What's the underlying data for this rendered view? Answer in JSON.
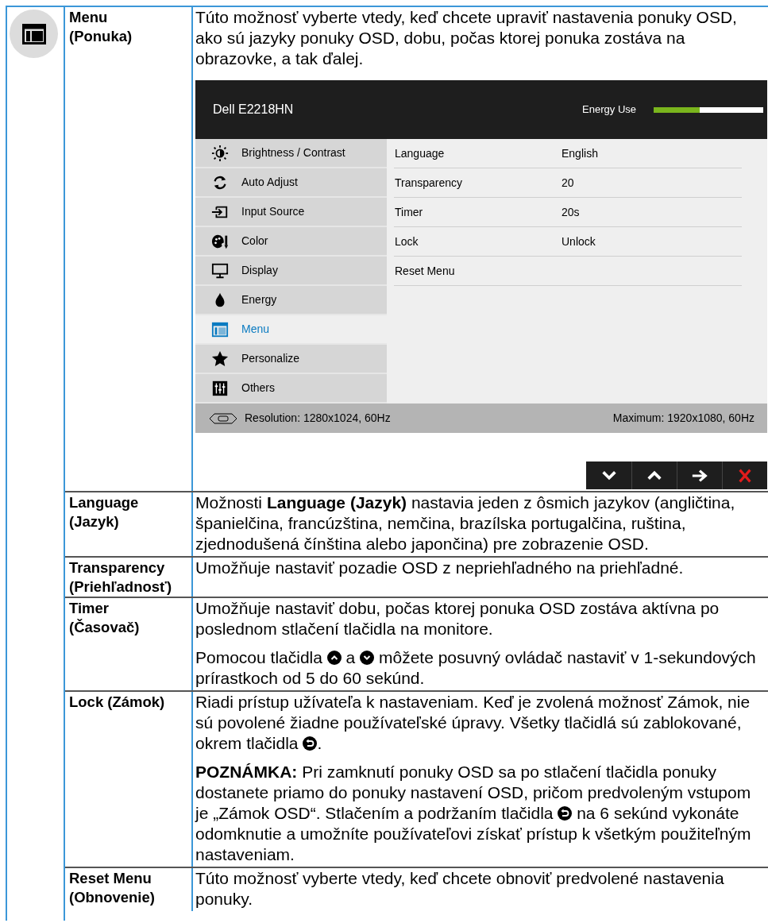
{
  "rows": [
    {
      "name": "Menu\n(Ponuka)",
      "paragraphs": [
        [
          {
            "kind": "text",
            "text": "Túto možnosť vyberte vtedy, keď chcete upraviť nastavenia ponuky OSD, ako sú jazyky ponuky OSD, dobu, počas ktorej ponuka zostáva na obrazovke, a tak ďalej."
          }
        ]
      ],
      "osd": {
        "model": "Dell E2218HN",
        "energy_label": "Energy Use",
        "energy": {
          "level": 0.42
        },
        "menu": [
          {
            "label": "Brightness / Contrast",
            "kind": "brightness",
            "selected": false
          },
          {
            "label": "Auto Adjust",
            "kind": "auto",
            "selected": false
          },
          {
            "label": "Input Source",
            "kind": "input",
            "selected": false
          },
          {
            "label": "Color",
            "kind": "color",
            "selected": false
          },
          {
            "label": "Display",
            "kind": "display",
            "selected": false
          },
          {
            "label": "Energy",
            "kind": "energy",
            "selected": false
          },
          {
            "label": "Menu",
            "kind": "menu",
            "selected": true
          },
          {
            "label": "Personalize",
            "kind": "personalize",
            "selected": false
          },
          {
            "label": "Others",
            "kind": "others",
            "selected": false
          }
        ],
        "settings": [
          {
            "label": "Language",
            "value": "English"
          },
          {
            "label": "Transparency",
            "value": "20"
          },
          {
            "label": "Timer",
            "value": "20s"
          },
          {
            "label": "Lock",
            "value": "Unlock"
          },
          {
            "label": "Reset Menu"
          }
        ],
        "resolution": "Resolution: 1280x1024, 60Hz",
        "maximum": "Maximum: 1920x1080, 60Hz",
        "buttons": [
          {
            "kind": "down"
          },
          {
            "kind": "up"
          },
          {
            "kind": "right"
          },
          {
            "kind": "close"
          }
        ]
      }
    },
    {
      "name": "Language\n(Jazyk)",
      "paragraphs": [
        [
          {
            "kind": "text",
            "text": "Možnosti **Language (Jazyk)** nastavia jeden z ôsmich jazykov (angličtina, španielčina, francúzština, nemčina, brazílska portugalčina, ruština, zjednodušená čínština alebo japončina) pre zobrazenie OSD."
          }
        ]
      ]
    },
    {
      "name": "Transparency\n(Priehľadnosť)",
      "paragraphs": [
        [
          {
            "kind": "text",
            "text": "Umožňuje nastaviť pozadie OSD z nepriehľadného na priehľadné."
          }
        ]
      ]
    },
    {
      "name": "Timer\n(Časovač)",
      "paragraphs": [
        [
          {
            "kind": "text",
            "text": "Umožňuje nastaviť dobu, počas ktorej ponuka OSD zostáva aktívna po poslednom stlačení tlačidla na monitore."
          }
        ],
        [
          {
            "kind": "text",
            "text": "Pomocou tlačidla "
          },
          {
            "kind": "up_button"
          },
          {
            "kind": "text",
            "text": " a "
          },
          {
            "kind": "down_button"
          },
          {
            "kind": "text",
            "text": " môžete posuvný ovládač nastaviť v 1-sekundových prírastkoch od 5 do 60 sekúnd."
          }
        ]
      ]
    },
    {
      "name": "Lock (Zámok)",
      "paragraphs": [
        [
          {
            "kind": "text",
            "text": "Riadi prístup užívateľa k nastaveniam. Keď je zvolená možnosť Zámok, nie sú povolené žiadne používateľské úpravy. Všetky tlačidlá sú zablokované, okrem tlačidla "
          },
          {
            "kind": "back_button"
          },
          {
            "kind": "text",
            "text": "."
          }
        ],
        [
          {
            "kind": "text",
            "text": "**POZNÁMKA:** Pri zamknutí ponuky OSD sa po stlačení tlačidla ponuky dostanete priamo do ponuky nastavení OSD, pričom predvoleným vstupom je „Zámok OSD“. Stlačením a podržaním tlačidla "
          },
          {
            "kind": "back_button"
          },
          {
            "kind": "text",
            "text": " na 6 sekúnd vykonáte odomknutie a umožníte používateľovi získať prístup k všetkým použiteľným nastaveniam."
          }
        ]
      ]
    },
    {
      "name": "Reset Menu\n(Obnovenie)",
      "paragraphs": [
        [
          {
            "kind": "text",
            "text": "Túto možnosť vyberte vtedy, keď chcete obnoviť predvolené nastavenia ponuky."
          }
        ]
      ]
    }
  ]
}
